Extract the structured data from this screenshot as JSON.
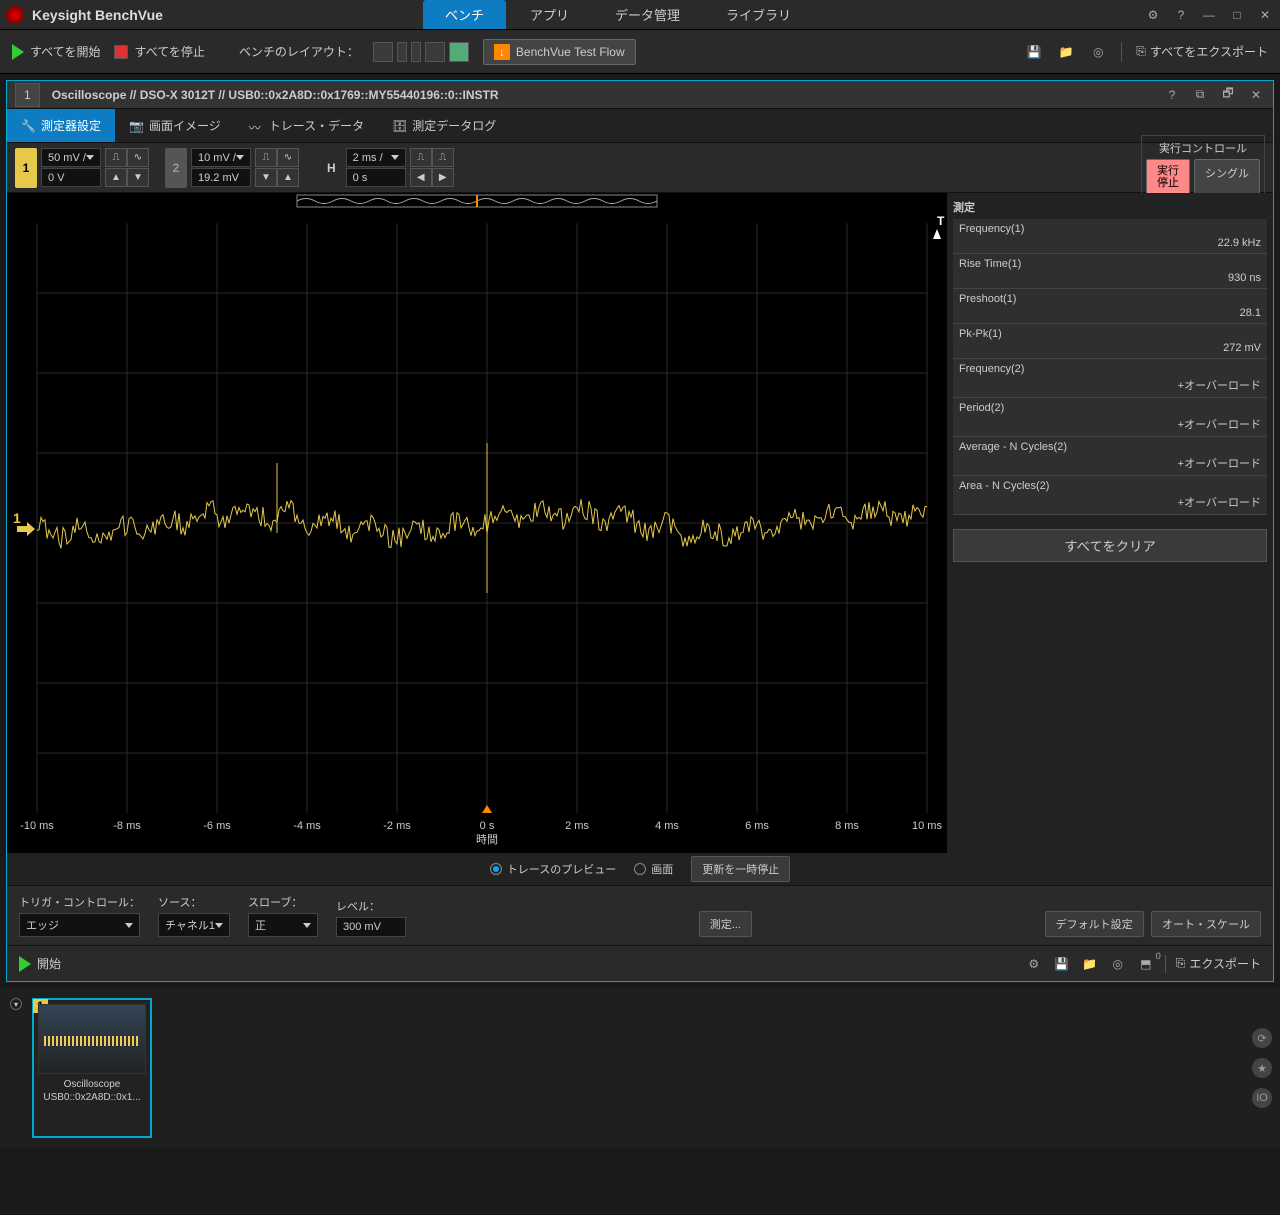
{
  "app": {
    "title": "Keysight BenchVue"
  },
  "top_tabs": {
    "bench": "ベンチ",
    "apps": "アプリ",
    "data": "データ管理",
    "library": "ライブラリ"
  },
  "toolbar": {
    "start_all": "すべてを開始",
    "stop_all": "すべてを停止",
    "bench_layout": "ベンチのレイアウト：",
    "test_flow": "BenchVue Test Flow",
    "export_all": "すべてをエクスポート"
  },
  "instrument": {
    "num": "1",
    "name": "Oscilloscope // DSO-X 3012T // USB0::0x2A8D::0x1769::MY55440196::0::INSTR"
  },
  "mode_tabs": {
    "settings": "測定器設定",
    "image": "画面イメージ",
    "trace": "トレース・データ",
    "datalog": "測定データログ"
  },
  "channels": {
    "ch1": {
      "num": "1",
      "scale": "50 mV /",
      "offset": "0 V"
    },
    "ch2": {
      "num": "2",
      "scale": "10 mV /",
      "offset": "19.2 mV"
    },
    "h_label": "H",
    "horiz": {
      "scale": "2 ms /",
      "offset": "0 s"
    }
  },
  "exec": {
    "title": "実行コントロール",
    "stop": "実行\n停止",
    "single": "シングル"
  },
  "plot": {
    "x_ticks": [
      "-10 ms",
      "-8 ms",
      "-6 ms",
      "-4 ms",
      "-2 ms",
      "0 s",
      "2 ms",
      "4 ms",
      "6 ms",
      "8 ms",
      "10 ms"
    ],
    "x_label": "時間",
    "trace_marker": "1",
    "trigger_marker": "T"
  },
  "meas": {
    "title": "測定",
    "items": [
      {
        "name": "Frequency(1)",
        "val": "22.9 kHz"
      },
      {
        "name": "Rise Time(1)",
        "val": "930 ns"
      },
      {
        "name": "Preshoot(1)",
        "val": "28.1"
      },
      {
        "name": "Pk-Pk(1)",
        "val": "272 mV"
      },
      {
        "name": "Frequency(2)",
        "val": "+オーバーロード"
      },
      {
        "name": "Period(2)",
        "val": "+オーバーロード"
      },
      {
        "name": "Average - N Cycles(2)",
        "val": "+オーバーロード"
      },
      {
        "name": "Area - N Cycles(2)",
        "val": "+オーバーロード"
      }
    ],
    "clear": "すべてをクリア"
  },
  "below": {
    "preview": "トレースのプレビュー",
    "screen": "画面",
    "pause": "更新を一時停止"
  },
  "trigger": {
    "ctrl_lbl": "トリガ・コントロール：",
    "source_lbl": "ソース：",
    "slope_lbl": "スローブ：",
    "level_lbl": "レベル：",
    "mode": "エッジ",
    "source": "チャネル1",
    "slope": "正",
    "level": "300 mV",
    "measure_btn": "測定...",
    "default": "デフォルト設定",
    "autoscale": "オート・スケール"
  },
  "start_row": {
    "start": "開始",
    "export": "エクスポート",
    "io_badge": "0"
  },
  "thumb": {
    "name": "Oscilloscope",
    "addr": "USB0::0x2A8D::0x1...",
    "num": "1"
  }
}
